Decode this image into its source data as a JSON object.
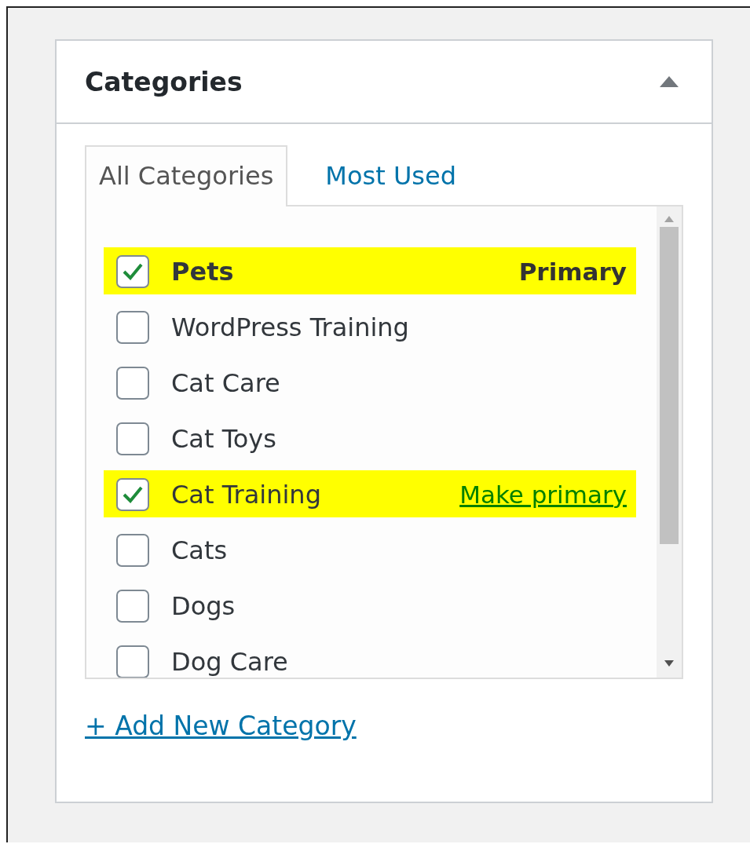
{
  "panel": {
    "title": "Categories",
    "expanded": true
  },
  "tabs": [
    {
      "label": "All Categories",
      "selected": true
    },
    {
      "label": "Most Used",
      "selected": false
    }
  ],
  "categories": [
    {
      "label": "Pets",
      "checked": true,
      "highlighted": true,
      "action": {
        "kind": "label",
        "text": "Primary"
      }
    },
    {
      "label": "WordPress Training",
      "checked": false,
      "highlighted": false
    },
    {
      "label": "Cat Care",
      "checked": false,
      "highlighted": false
    },
    {
      "label": "Cat Toys",
      "checked": false,
      "highlighted": false
    },
    {
      "label": "Cat Training",
      "checked": true,
      "highlighted": true,
      "action": {
        "kind": "link",
        "text": "Make primary"
      }
    },
    {
      "label": "Cats",
      "checked": false,
      "highlighted": false
    },
    {
      "label": "Dogs",
      "checked": false,
      "highlighted": false
    },
    {
      "label": "Dog Care",
      "checked": false,
      "highlighted": false
    }
  ],
  "add_link": "+ Add New Category"
}
